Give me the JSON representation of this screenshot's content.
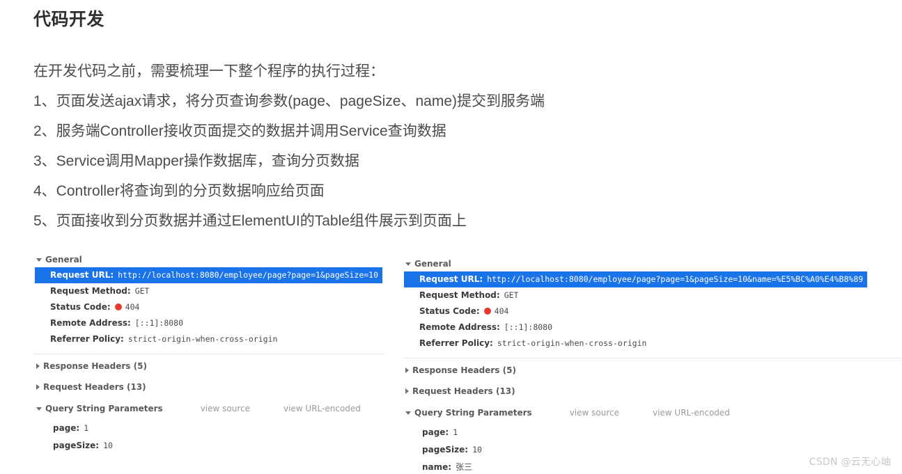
{
  "article": {
    "title": "代码开发",
    "intro": "在开发代码之前，需要梳理一下整个程序的执行过程：",
    "steps": [
      "1、页面发送ajax请求，将分页查询参数(page、pageSize、name)提交到服务端",
      "2、服务端Controller接收页面提交的数据并调用Service查询数据",
      "3、Service调用Mapper操作数据库，查询分页数据",
      "4、Controller将查询到的分页数据响应给页面",
      "5、页面接收到分页数据并通过ElementUI的Table组件展示到页面上"
    ]
  },
  "devtools": {
    "left_panel": {
      "general_label": "General",
      "request_url_key": "Request URL:",
      "request_url_value": "http://localhost:8080/employee/page?page=1&pageSize=10",
      "request_method_key": "Request Method:",
      "request_method_value": "GET",
      "status_code_key": "Status Code:",
      "status_code_value": "404",
      "status_dot_color": "#e8392b",
      "remote_address_key": "Remote Address:",
      "remote_address_value": "[::1]:8080",
      "referrer_policy_key": "Referrer Policy:",
      "referrer_policy_value": "strict-origin-when-cross-origin",
      "response_headers_label": "Response Headers (5)",
      "request_headers_label": "Request Headers (13)",
      "query_string_label": "Query String Parameters",
      "view_source_label": "view source",
      "view_url_encoded_label": "view URL-encoded",
      "params": [
        {
          "key": "page:",
          "value": "1",
          "cjk": false
        },
        {
          "key": "pageSize:",
          "value": "10",
          "cjk": false
        }
      ]
    },
    "right_panel": {
      "general_label": "General",
      "request_url_key": "Request URL:",
      "request_url_value": "http://localhost:8080/employee/page?page=1&pageSize=10&name=%E5%BC%A0%E4%B8%89",
      "request_method_key": "Request Method:",
      "request_method_value": "GET",
      "status_code_key": "Status Code:",
      "status_code_value": "404",
      "status_dot_color": "#e8392b",
      "remote_address_key": "Remote Address:",
      "remote_address_value": "[::1]:8080",
      "referrer_policy_key": "Referrer Policy:",
      "referrer_policy_value": "strict-origin-when-cross-origin",
      "response_headers_label": "Response Headers (5)",
      "request_headers_label": "Request Headers (13)",
      "query_string_label": "Query String Parameters",
      "view_source_label": "view source",
      "view_url_encoded_label": "view URL-encoded",
      "params": [
        {
          "key": "page:",
          "value": "1",
          "cjk": false
        },
        {
          "key": "pageSize:",
          "value": "10",
          "cjk": false
        },
        {
          "key": "name:",
          "value": "张三",
          "cjk": true
        }
      ]
    },
    "highlight_color": "#1a73e8"
  },
  "watermark": "CSDN @云无心岫"
}
